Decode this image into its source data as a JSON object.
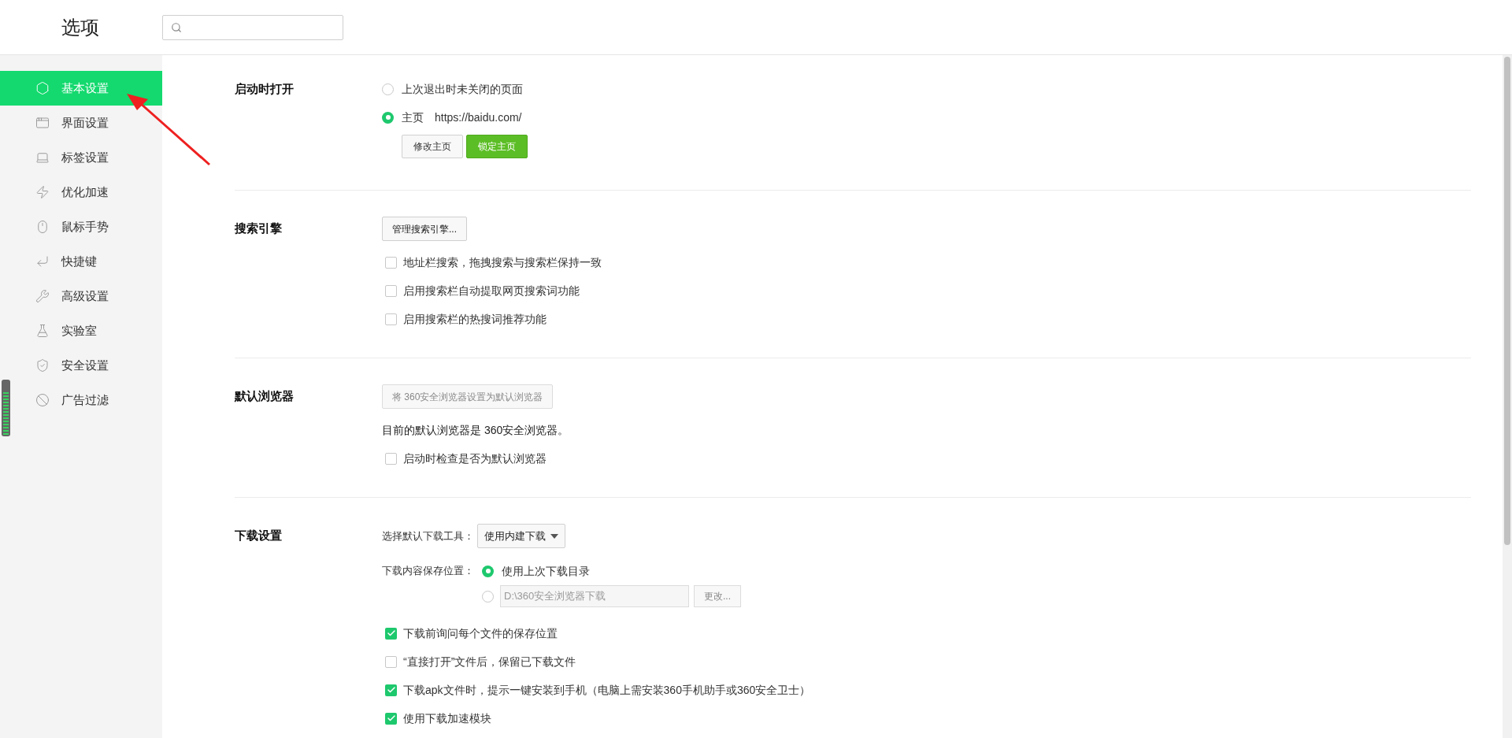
{
  "header": {
    "title": "选项"
  },
  "sidebar": {
    "items": [
      {
        "label": "基本设置",
        "selected": true
      },
      {
        "label": "界面设置",
        "selected": false
      },
      {
        "label": "标签设置",
        "selected": false
      },
      {
        "label": "优化加速",
        "selected": false
      },
      {
        "label": "鼠标手势",
        "selected": false
      },
      {
        "label": "快捷键",
        "selected": false
      },
      {
        "label": "高级设置",
        "selected": false
      },
      {
        "label": "实验室",
        "selected": false
      },
      {
        "label": "安全设置",
        "selected": false
      },
      {
        "label": "广告过滤",
        "selected": false
      }
    ]
  },
  "sections": [
    {
      "title": "启动时打开",
      "rows": [
        {
          "kind": "radio",
          "label": "上次退出时未关闭的页面",
          "selected": false
        },
        {
          "kind": "radio",
          "label": "主页",
          "detail": "https://baidu.com/",
          "selected": true
        },
        {
          "kind": "buttons",
          "buttons": [
            {
              "label": "修改主页",
              "primary": false
            },
            {
              "label": "锁定主页",
              "primary": true
            }
          ]
        }
      ]
    },
    {
      "title": "搜索引擎",
      "rows": [
        {
          "kind": "button",
          "label": "管理搜索引擎...",
          "disabled": false
        },
        {
          "kind": "checkbox",
          "label": "地址栏搜索，拖拽搜索与搜索栏保持一致",
          "checked": false
        },
        {
          "kind": "checkbox",
          "label": "启用搜索栏自动提取网页搜索词功能",
          "checked": false
        },
        {
          "kind": "checkbox",
          "label": "启用搜索栏的热搜词推荐功能",
          "checked": false
        }
      ]
    },
    {
      "title": "默认浏览器",
      "rows": [
        {
          "kind": "button",
          "label": "将 360安全浏览器设置为默认浏览器",
          "disabled": true
        },
        {
          "kind": "text",
          "label": "目前的默认浏览器是 360安全浏览器。"
        },
        {
          "kind": "checkbox",
          "label": "启动时检查是否为默认浏览器",
          "checked": false
        }
      ]
    },
    {
      "title": "下载设置",
      "rows": [
        {
          "kind": "select",
          "label": "选择默认下载工具：",
          "value": "使用内建下载"
        },
        {
          "kind": "location",
          "label": "下载内容保存位置：",
          "options": [
            {
              "label": "使用上次下载目录",
              "selected": true
            },
            {
              "path": "D:\\360安全浏览器下载",
              "button": "更改...",
              "selected": false
            }
          ]
        },
        {
          "kind": "checkbox",
          "label": "下载前询问每个文件的保存位置",
          "checked": true
        },
        {
          "kind": "checkbox",
          "label": "“直接打开”文件后，保留已下载文件",
          "checked": false
        },
        {
          "kind": "checkbox",
          "label": "下载apk文件时，提示一键安装到手机（电脑上需安装360手机助手或360安全卫士）",
          "checked": true
        },
        {
          "kind": "checkbox",
          "label": "使用下载加速模块",
          "checked": true
        }
      ]
    }
  ]
}
